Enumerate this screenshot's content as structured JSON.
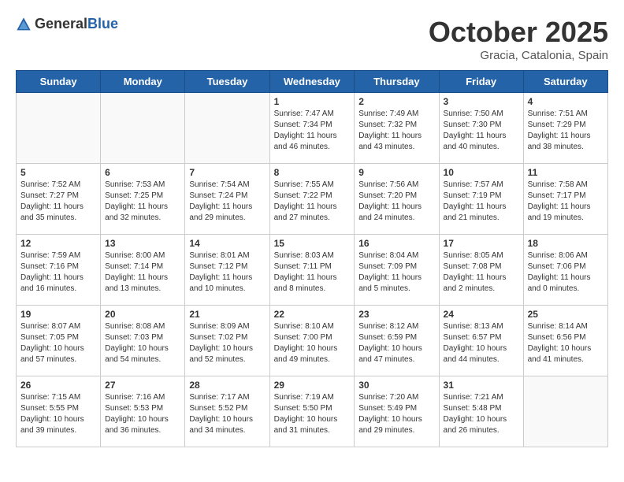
{
  "header": {
    "logo_general": "General",
    "logo_blue": "Blue",
    "month_title": "October 2025",
    "location": "Gracia, Catalonia, Spain"
  },
  "days_of_week": [
    "Sunday",
    "Monday",
    "Tuesday",
    "Wednesday",
    "Thursday",
    "Friday",
    "Saturday"
  ],
  "weeks": [
    [
      {
        "day": "",
        "info": ""
      },
      {
        "day": "",
        "info": ""
      },
      {
        "day": "",
        "info": ""
      },
      {
        "day": "1",
        "info": "Sunrise: 7:47 AM\nSunset: 7:34 PM\nDaylight: 11 hours and 46 minutes."
      },
      {
        "day": "2",
        "info": "Sunrise: 7:49 AM\nSunset: 7:32 PM\nDaylight: 11 hours and 43 minutes."
      },
      {
        "day": "3",
        "info": "Sunrise: 7:50 AM\nSunset: 7:30 PM\nDaylight: 11 hours and 40 minutes."
      },
      {
        "day": "4",
        "info": "Sunrise: 7:51 AM\nSunset: 7:29 PM\nDaylight: 11 hours and 38 minutes."
      }
    ],
    [
      {
        "day": "5",
        "info": "Sunrise: 7:52 AM\nSunset: 7:27 PM\nDaylight: 11 hours and 35 minutes."
      },
      {
        "day": "6",
        "info": "Sunrise: 7:53 AM\nSunset: 7:25 PM\nDaylight: 11 hours and 32 minutes."
      },
      {
        "day": "7",
        "info": "Sunrise: 7:54 AM\nSunset: 7:24 PM\nDaylight: 11 hours and 29 minutes."
      },
      {
        "day": "8",
        "info": "Sunrise: 7:55 AM\nSunset: 7:22 PM\nDaylight: 11 hours and 27 minutes."
      },
      {
        "day": "9",
        "info": "Sunrise: 7:56 AM\nSunset: 7:20 PM\nDaylight: 11 hours and 24 minutes."
      },
      {
        "day": "10",
        "info": "Sunrise: 7:57 AM\nSunset: 7:19 PM\nDaylight: 11 hours and 21 minutes."
      },
      {
        "day": "11",
        "info": "Sunrise: 7:58 AM\nSunset: 7:17 PM\nDaylight: 11 hours and 19 minutes."
      }
    ],
    [
      {
        "day": "12",
        "info": "Sunrise: 7:59 AM\nSunset: 7:16 PM\nDaylight: 11 hours and 16 minutes."
      },
      {
        "day": "13",
        "info": "Sunrise: 8:00 AM\nSunset: 7:14 PM\nDaylight: 11 hours and 13 minutes."
      },
      {
        "day": "14",
        "info": "Sunrise: 8:01 AM\nSunset: 7:12 PM\nDaylight: 11 hours and 10 minutes."
      },
      {
        "day": "15",
        "info": "Sunrise: 8:03 AM\nSunset: 7:11 PM\nDaylight: 11 hours and 8 minutes."
      },
      {
        "day": "16",
        "info": "Sunrise: 8:04 AM\nSunset: 7:09 PM\nDaylight: 11 hours and 5 minutes."
      },
      {
        "day": "17",
        "info": "Sunrise: 8:05 AM\nSunset: 7:08 PM\nDaylight: 11 hours and 2 minutes."
      },
      {
        "day": "18",
        "info": "Sunrise: 8:06 AM\nSunset: 7:06 PM\nDaylight: 11 hours and 0 minutes."
      }
    ],
    [
      {
        "day": "19",
        "info": "Sunrise: 8:07 AM\nSunset: 7:05 PM\nDaylight: 10 hours and 57 minutes."
      },
      {
        "day": "20",
        "info": "Sunrise: 8:08 AM\nSunset: 7:03 PM\nDaylight: 10 hours and 54 minutes."
      },
      {
        "day": "21",
        "info": "Sunrise: 8:09 AM\nSunset: 7:02 PM\nDaylight: 10 hours and 52 minutes."
      },
      {
        "day": "22",
        "info": "Sunrise: 8:10 AM\nSunset: 7:00 PM\nDaylight: 10 hours and 49 minutes."
      },
      {
        "day": "23",
        "info": "Sunrise: 8:12 AM\nSunset: 6:59 PM\nDaylight: 10 hours and 47 minutes."
      },
      {
        "day": "24",
        "info": "Sunrise: 8:13 AM\nSunset: 6:57 PM\nDaylight: 10 hours and 44 minutes."
      },
      {
        "day": "25",
        "info": "Sunrise: 8:14 AM\nSunset: 6:56 PM\nDaylight: 10 hours and 41 minutes."
      }
    ],
    [
      {
        "day": "26",
        "info": "Sunrise: 7:15 AM\nSunset: 5:55 PM\nDaylight: 10 hours and 39 minutes."
      },
      {
        "day": "27",
        "info": "Sunrise: 7:16 AM\nSunset: 5:53 PM\nDaylight: 10 hours and 36 minutes."
      },
      {
        "day": "28",
        "info": "Sunrise: 7:17 AM\nSunset: 5:52 PM\nDaylight: 10 hours and 34 minutes."
      },
      {
        "day": "29",
        "info": "Sunrise: 7:19 AM\nSunset: 5:50 PM\nDaylight: 10 hours and 31 minutes."
      },
      {
        "day": "30",
        "info": "Sunrise: 7:20 AM\nSunset: 5:49 PM\nDaylight: 10 hours and 29 minutes."
      },
      {
        "day": "31",
        "info": "Sunrise: 7:21 AM\nSunset: 5:48 PM\nDaylight: 10 hours and 26 minutes."
      },
      {
        "day": "",
        "info": ""
      }
    ]
  ]
}
